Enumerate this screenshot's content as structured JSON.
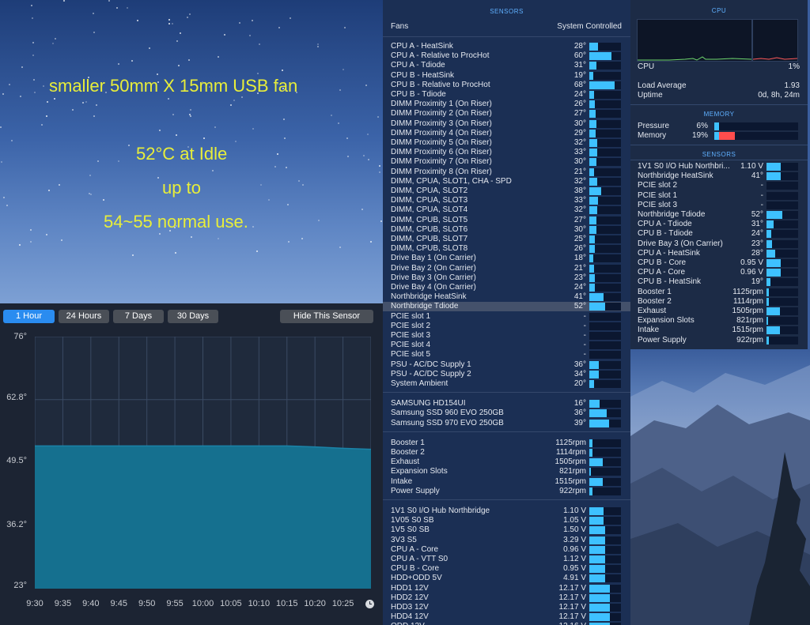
{
  "annotation": {
    "line1": "smaller 50mm X 15mm USB fan",
    "line2": "52°C at Idle",
    "line3": "up to",
    "line4": "54~55  normal use."
  },
  "history": {
    "tabs": [
      "1 Hour",
      "24 Hours",
      "7 Days",
      "30 Days"
    ],
    "active_tab": "1 Hour",
    "hide_button": "Hide This Sensor"
  },
  "chart_data": {
    "type": "area",
    "y_ticks": [
      "76°",
      "62.8°",
      "49.5°",
      "36.2°",
      "23°"
    ],
    "ylim": [
      23,
      76
    ],
    "x_ticks": [
      "9:30",
      "9:35",
      "9:40",
      "9:45",
      "9:50",
      "9:55",
      "10:00",
      "10:05",
      "10:10",
      "10:15",
      "10:20",
      "10:25"
    ],
    "grid": true,
    "series": [
      {
        "x": [
          "9:30",
          "9:35",
          "9:40",
          "9:45",
          "9:50",
          "9:55",
          "10:00",
          "10:05",
          "10:10",
          "10:15",
          "10:20",
          "10:25",
          "10:30"
        ],
        "values": [
          53,
          53,
          53,
          53,
          53,
          53,
          53,
          53,
          53,
          53,
          52.8,
          52.5,
          52.3
        ]
      }
    ],
    "fill_color": "#15708f"
  },
  "sensors": {
    "title": "SENSORS",
    "header_label": "Fans",
    "header_value": "System Controlled",
    "highlighted": "Northbridge Tdiode",
    "groups": [
      [
        {
          "label": "CPU A - HeatSink",
          "value": "28°",
          "fill": 0.28
        },
        {
          "label": "CPU A - Relative to ProcHot",
          "value": "60°",
          "fill": 0.7
        },
        {
          "label": "CPU A - Tdiode",
          "value": "31°",
          "fill": 0.22
        },
        {
          "label": "CPU B - HeatSink",
          "value": "19°",
          "fill": 0.12
        },
        {
          "label": "CPU B - Relative to ProcHot",
          "value": "68°",
          "fill": 0.8
        },
        {
          "label": "CPU B - Tdiode",
          "value": "24°",
          "fill": 0.14
        },
        {
          "label": "DIMM Proximity 1 (On Riser)",
          "value": "26°",
          "fill": 0.18
        },
        {
          "label": "DIMM Proximity 2 (On Riser)",
          "value": "27°",
          "fill": 0.19
        },
        {
          "label": "DIMM Proximity 3 (On Riser)",
          "value": "30°",
          "fill": 0.22
        },
        {
          "label": "DIMM Proximity 4 (On Riser)",
          "value": "29°",
          "fill": 0.21
        },
        {
          "label": "DIMM Proximity 5 (On Riser)",
          "value": "32°",
          "fill": 0.24
        },
        {
          "label": "DIMM Proximity 6 (On Riser)",
          "value": "33°",
          "fill": 0.25
        },
        {
          "label": "DIMM Proximity 7 (On Riser)",
          "value": "30°",
          "fill": 0.22
        },
        {
          "label": "DIMM Proximity 8 (On Riser)",
          "value": "21°",
          "fill": 0.14
        },
        {
          "label": "DIMM, CPUA, SLOT1, CHA - SPD",
          "value": "32°",
          "fill": 0.24
        },
        {
          "label": "DIMM, CPUA, SLOT2",
          "value": "38°",
          "fill": 0.38
        },
        {
          "label": "DIMM, CPUA, SLOT3",
          "value": "33°",
          "fill": 0.27
        },
        {
          "label": "DIMM, CPUA, SLOT4",
          "value": "32°",
          "fill": 0.26
        },
        {
          "label": "DIMM, CPUB, SLOT5",
          "value": "27°",
          "fill": 0.22
        },
        {
          "label": "DIMM, CPUB, SLOT6",
          "value": "30°",
          "fill": 0.22
        },
        {
          "label": "DIMM, CPUB, SLOT7",
          "value": "25°",
          "fill": 0.18
        },
        {
          "label": "DIMM, CPUB, SLOT8",
          "value": "26°",
          "fill": 0.18
        },
        {
          "label": "Drive Bay 1 (On Carrier)",
          "value": "18°",
          "fill": 0.12
        },
        {
          "label": "Drive Bay 2 (On Carrier)",
          "value": "21°",
          "fill": 0.15
        },
        {
          "label": "Drive Bay 3 (On Carrier)",
          "value": "23°",
          "fill": 0.18
        },
        {
          "label": "Drive Bay 4 (On Carrier)",
          "value": "24°",
          "fill": 0.18
        },
        {
          "label": "Northbridge HeatSink",
          "value": "41°",
          "fill": 0.45
        },
        {
          "label": "Northbridge Tdiode",
          "value": "52°",
          "fill": 0.5
        },
        {
          "label": "PCIE slot 1",
          "value": "-",
          "fill": 0
        },
        {
          "label": "PCIE slot 2",
          "value": "-",
          "fill": 0
        },
        {
          "label": "PCIE slot 3",
          "value": "-",
          "fill": 0
        },
        {
          "label": "PCIE slot 4",
          "value": "-",
          "fill": 0
        },
        {
          "label": "PCIE slot 5",
          "value": "-",
          "fill": 0
        },
        {
          "label": "PSU - AC/DC Supply 1",
          "value": "36°",
          "fill": 0.3
        },
        {
          "label": "PSU - AC/DC Supply 2",
          "value": "34°",
          "fill": 0.3
        },
        {
          "label": "System Ambient",
          "value": "20°",
          "fill": 0.15
        }
      ],
      [
        {
          "label": "SAMSUNG HD154UI",
          "value": "16°",
          "fill": 0.32
        },
        {
          "label": "Samsung SSD 960 EVO 250GB",
          "value": "36°",
          "fill": 0.55
        },
        {
          "label": "Samsung SSD 970 EVO 250GB",
          "value": "39°",
          "fill": 0.62
        }
      ],
      [
        {
          "label": "Booster 1",
          "value": "1125rpm",
          "fill": 0.1
        },
        {
          "label": "Booster 2",
          "value": "1114rpm",
          "fill": 0.1
        },
        {
          "label": "Exhaust",
          "value": "1505rpm",
          "fill": 0.42
        },
        {
          "label": "Expansion Slots",
          "value": "821rpm",
          "fill": 0.06
        },
        {
          "label": "Intake",
          "value": "1515rpm",
          "fill": 0.42
        },
        {
          "label": "Power Supply",
          "value": "922rpm",
          "fill": 0.1
        }
      ],
      [
        {
          "label": "1V1 S0 I/O Hub Northbridge",
          "value": "1.10 V",
          "fill": 0.45
        },
        {
          "label": "1V05 S0 SB",
          "value": "1.05 V",
          "fill": 0.45
        },
        {
          "label": "1V5 S0 SB",
          "value": "1.50 V",
          "fill": 0.5
        },
        {
          "label": "3V3 S5",
          "value": "3.29 V",
          "fill": 0.5
        },
        {
          "label": "CPU A - Core",
          "value": "0.96 V",
          "fill": 0.5
        },
        {
          "label": "CPU A - VTT S0",
          "value": "1.12 V",
          "fill": 0.5
        },
        {
          "label": "CPU B - Core",
          "value": "0.95 V",
          "fill": 0.5
        },
        {
          "label": "HDD+ODD 5V",
          "value": "4.91 V",
          "fill": 0.5
        },
        {
          "label": "HDD1 12V",
          "value": "12.17 V",
          "fill": 0.65
        },
        {
          "label": "HDD2 12V",
          "value": "12.17 V",
          "fill": 0.65
        },
        {
          "label": "HDD3 12V",
          "value": "12.17 V",
          "fill": 0.65
        },
        {
          "label": "HDD4 12V",
          "value": "12.17 V",
          "fill": 0.65
        },
        {
          "label": "ODD 12V",
          "value": "12.16 V",
          "fill": 0.65
        }
      ]
    ]
  },
  "widget": {
    "cpu_title": "CPU",
    "cpu_label": "CPU",
    "cpu_value": "1%",
    "load_label": "Load Average",
    "load_value": "1.93",
    "uptime_label": "Uptime",
    "uptime_value": "0d, 8h, 24m",
    "memory_title": "MEMORY",
    "pressure_label": "Pressure",
    "pressure_value": "6%",
    "pressure_fill": 0.06,
    "memory_label": "Memory",
    "memory_value": "19%",
    "memory_fill": 0.19,
    "sensors_title": "SENSORS",
    "sensors": [
      {
        "label": "1V1 S0 I/O Hub Northbri...",
        "value": "1.10 V",
        "fill": 0.45
      },
      {
        "label": "Northbridge HeatSink",
        "value": "41°",
        "fill": 0.45
      },
      {
        "label": "PCIE slot 2",
        "value": "-",
        "fill": 0
      },
      {
        "label": "PCIE slot 1",
        "value": "-",
        "fill": 0
      },
      {
        "label": "PCIE slot 3",
        "value": "-",
        "fill": 0
      },
      {
        "label": "Northbridge Tdiode",
        "value": "52°",
        "fill": 0.5
      },
      {
        "label": "CPU A - Tdiode",
        "value": "31°",
        "fill": 0.22
      },
      {
        "label": "CPU B - Tdiode",
        "value": "24°",
        "fill": 0.14
      },
      {
        "label": "Drive Bay 3 (On Carrier)",
        "value": "23°",
        "fill": 0.18
      },
      {
        "label": "CPU A - HeatSink",
        "value": "28°",
        "fill": 0.28
      },
      {
        "label": "CPU B - Core",
        "value": "0.95 V",
        "fill": 0.45
      },
      {
        "label": "CPU A - Core",
        "value": "0.96 V",
        "fill": 0.45
      },
      {
        "label": "CPU B - HeatSink",
        "value": "19°",
        "fill": 0.12
      },
      {
        "label": "Booster 1",
        "value": "1125rpm",
        "fill": 0.08
      },
      {
        "label": "Booster 2",
        "value": "1114rpm",
        "fill": 0.08
      },
      {
        "label": "Exhaust",
        "value": "1505rpm",
        "fill": 0.42
      },
      {
        "label": "Expansion Slots",
        "value": "821rpm",
        "fill": 0.05
      },
      {
        "label": "Intake",
        "value": "1515rpm",
        "fill": 0.42
      },
      {
        "label": "Power Supply",
        "value": "922rpm",
        "fill": 0.08
      }
    ]
  }
}
